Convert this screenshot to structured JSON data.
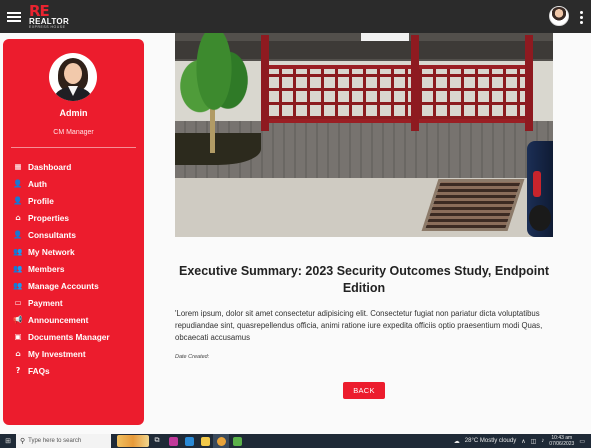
{
  "topbar": {
    "logo_mark": "RE",
    "logo_name": "REALTOR",
    "logo_tagline": "EXPRESS HOUSE"
  },
  "sidebar": {
    "user_name": "Admin",
    "user_role": "CM Manager",
    "items": [
      {
        "label": "Dashboard",
        "icon": "dashboard-icon",
        "glyph": "▦"
      },
      {
        "label": "Auth",
        "icon": "user-icon",
        "glyph": "👤"
      },
      {
        "label": "Profile",
        "icon": "user-icon",
        "glyph": "👤"
      },
      {
        "label": "Properties",
        "icon": "home-icon",
        "glyph": "⌂"
      },
      {
        "label": "Consultants",
        "icon": "user-icon",
        "glyph": "👤"
      },
      {
        "label": "My Network",
        "icon": "group-icon",
        "glyph": "👥"
      },
      {
        "label": "Members",
        "icon": "group-icon",
        "glyph": "👥"
      },
      {
        "label": "Manage Accounts",
        "icon": "accounts-icon",
        "glyph": "👥"
      },
      {
        "label": "Payment",
        "icon": "credit-card-icon",
        "glyph": "▭"
      },
      {
        "label": "Announcement",
        "icon": "megaphone-icon",
        "glyph": "📢"
      },
      {
        "label": "Documents Manager",
        "icon": "folder-icon",
        "glyph": "▣"
      },
      {
        "label": "My Investment",
        "icon": "home-icon",
        "glyph": "⌂"
      },
      {
        "label": "FAQs",
        "icon": "help-icon",
        "glyph": "?"
      }
    ]
  },
  "article": {
    "title": "Executive Summary: 2023 Security Outcomes Study, Endpoint Edition",
    "body": "'Lorem ipsum, dolor sit amet consectetur adipisicing elit. Consectetur fugiat non pariatur dicta voluptatibus repudiandae sint, quasrepellendus officia, animi ratione iure expedita officiis optio praesentium modi Quas, obcaecati accusamus",
    "date_label": "Date Created:",
    "back_label": "BACK"
  },
  "taskbar": {
    "search_placeholder": "Type here to search",
    "weather": "28°C  Mostly cloudy",
    "time": "10:43 am",
    "date": "07/06/2023"
  },
  "colors": {
    "accent": "#ec1c2d",
    "topbar": "#2b2b2b",
    "taskbar": "#1f2a37"
  }
}
